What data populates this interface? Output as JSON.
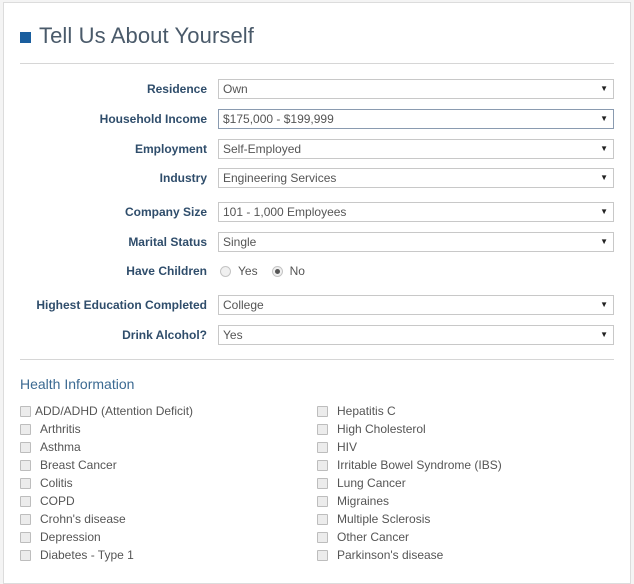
{
  "header": {
    "title": "Tell Us About Yourself",
    "accent_color": "#1a5e9e"
  },
  "form": {
    "residence": {
      "label": "Residence",
      "value": "Own"
    },
    "household_income": {
      "label": "Household Income",
      "value": "$175,000 - $199,999"
    },
    "employment": {
      "label": "Employment",
      "value": "Self-Employed"
    },
    "industry": {
      "label": "Industry",
      "value": "Engineering Services"
    },
    "company_size": {
      "label": "Company Size",
      "value": "101 - 1,000 Employees"
    },
    "marital_status": {
      "label": "Marital Status",
      "value": "Single"
    },
    "have_children": {
      "label": "Have Children",
      "options": [
        {
          "label": "Yes",
          "checked": false
        },
        {
          "label": "No",
          "checked": true
        }
      ]
    },
    "education": {
      "label": "Highest Education Completed",
      "value": "College"
    },
    "drink_alcohol": {
      "label": "Drink Alcohol?",
      "value": "Yes"
    },
    "dropdown_arrow": "▼"
  },
  "health": {
    "title": "Health Information",
    "left_column": [
      "ADD/ADHD (Attention Deficit)",
      "Arthritis",
      "Asthma",
      "Breast Cancer",
      "Colitis",
      "COPD",
      "Crohn's disease",
      "Depression",
      "Diabetes - Type 1"
    ],
    "right_column": [
      "Hepatitis C",
      "High Cholesterol",
      "HIV",
      "Irritable Bowel Syndrome (IBS)",
      "Lung Cancer",
      "Migraines",
      "Multiple Sclerosis",
      "Other Cancer",
      "Parkinson's disease"
    ]
  }
}
